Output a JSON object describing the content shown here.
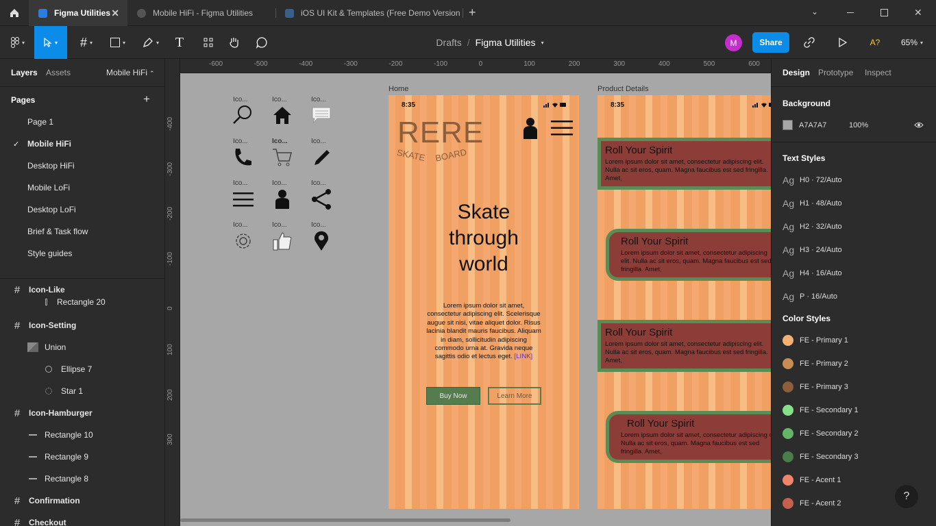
{
  "tabs": [
    {
      "label": "Figma Utilities",
      "active": true
    },
    {
      "label": "Mobile HiFi - Figma Utilities"
    },
    {
      "label": "iOS UI Kit & Templates (Free Demo Version"
    }
  ],
  "toolbar": {
    "breadcrumb_root": "Drafts",
    "breadcrumb_sep": "/",
    "file_name": "Figma Utilities",
    "avatar_letter": "M",
    "share_label": "Share",
    "a_label": "A?",
    "zoom": "65%"
  },
  "left_panel": {
    "tab_layers": "Layers",
    "tab_assets": "Assets",
    "page_switcher": "Mobile HiFi",
    "pages_title": "Pages",
    "pages": [
      "Page 1",
      "Mobile HiFi",
      "Desktop HiFi",
      "Mobile LoFi",
      "Desktop LoFi",
      "Brief & Task flow",
      "Style guides"
    ],
    "selected_page": "Mobile HiFi",
    "layers": [
      {
        "label": "Icon-Like",
        "type": "frame"
      },
      {
        "label": "Rectangle 20",
        "type": "rect"
      },
      {
        "label": "Icon-Setting",
        "type": "frame"
      },
      {
        "label": "Union",
        "type": "union"
      },
      {
        "label": "Ellipse 7",
        "type": "ellipse"
      },
      {
        "label": "Star 1",
        "type": "star"
      },
      {
        "label": "Icon-Hamburger",
        "type": "frame"
      },
      {
        "label": "Rectangle 10",
        "type": "line"
      },
      {
        "label": "Rectangle 9",
        "type": "line"
      },
      {
        "label": "Rectangle 8",
        "type": "line"
      },
      {
        "label": "Confirmation",
        "type": "frame"
      },
      {
        "label": "Checkout",
        "type": "frame"
      }
    ]
  },
  "rulers": {
    "top": [
      "-600",
      "-500",
      "-400",
      "-300",
      "-200",
      "-100",
      "0",
      "100",
      "200",
      "300",
      "400",
      "500",
      "600"
    ],
    "left": [
      "-400",
      "-300",
      "-200",
      "-100",
      "0",
      "100",
      "200",
      "300"
    ]
  },
  "canvas": {
    "icon_labels": [
      "Ico...",
      "Ico...",
      "Ico...",
      "Ico...",
      "Ico...",
      "Ico...",
      "Ico...",
      "Ico...",
      "Ico...",
      "Ico...",
      "Ico...",
      "Ico..."
    ],
    "frame_home_label": "Home",
    "frame_product_label": "Product Details",
    "status_time": "8:35",
    "logo_main": "RERE",
    "logo_sub_left": "SKATE",
    "logo_sub_right": "BOARD",
    "hero_line1": "Skate",
    "hero_line2": "through",
    "hero_line3": "world",
    "body_text": "Lorem ipsum dolor sit amet, consectetur adipiscing elit. Scelerisque augue sit nisi, vitae aliquet dolor. Risus lacinia blandit mauris faucibus. Aliquam in diam, sollicitudin adipiscing commodo urna at. Gravida neque sagittis odio et lectus eget.",
    "link_text": "[LINK]",
    "buy_label": "Buy Now",
    "learn_label": "Learn More",
    "card_title": "Roll Your Spirit",
    "card_body": "Lorem ipsum dolor sit amet, consectetur adipiscing elit. Nulla ac sit eros, quam. Magna faucibus est sed fringilla. Amet,"
  },
  "right_panel": {
    "tab_design": "Design",
    "tab_prototype": "Prototype",
    "tab_inspect": "Inspect",
    "background_title": "Background",
    "bg_hex": "A7A7A7",
    "bg_opacity": "100%",
    "text_styles_title": "Text Styles",
    "text_styles": [
      {
        "ag": "Ag",
        "name": "H0",
        "size": "72/Auto"
      },
      {
        "ag": "Ag",
        "name": "H1",
        "size": "48/Auto"
      },
      {
        "ag": "Ag",
        "name": "H2",
        "size": "32/Auto"
      },
      {
        "ag": "Ag",
        "name": "H3",
        "size": "24/Auto"
      },
      {
        "ag": "Ag",
        "name": "H4",
        "size": "16/Auto"
      },
      {
        "ag": "Ag",
        "name": "P",
        "size": "16/Auto"
      }
    ],
    "color_styles_title": "Color Styles",
    "color_styles": [
      {
        "name": "FE - Primary 1",
        "color": "#f4b176"
      },
      {
        "name": "FE - Primary 2",
        "color": "#c88d55"
      },
      {
        "name": "FE - Primary 3",
        "color": "#8c5e3c"
      },
      {
        "name": "FE - Secondary 1",
        "color": "#86e087"
      },
      {
        "name": "FE - Secondary 2",
        "color": "#64b566"
      },
      {
        "name": "FE - Secondary 3",
        "color": "#4a7c4c"
      },
      {
        "name": "FE - Acent 1",
        "color": "#f0846a"
      },
      {
        "name": "FE - Acent 2",
        "color": "#c4604e"
      }
    ]
  },
  "help_label": "?"
}
